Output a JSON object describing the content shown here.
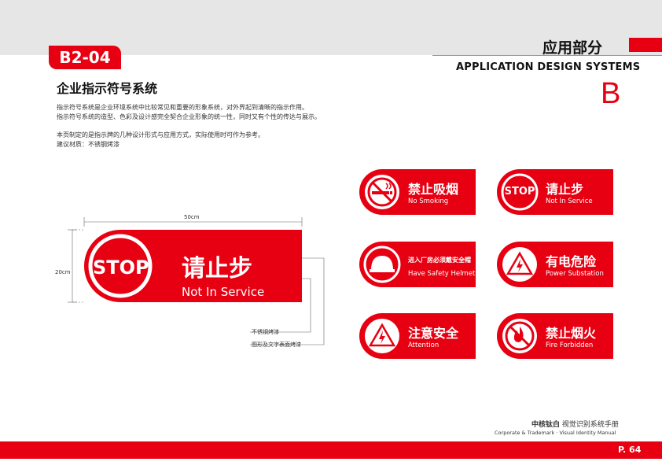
{
  "header": {
    "code": "B2-04",
    "section_cn": "应用部分",
    "section_en": "APPLICATION DESIGN SYSTEMS",
    "section_letter": "B"
  },
  "page_title": "企业指示符号系统",
  "description": [
    "指示符号系统是企业环境系统中比较常见和重要的形象系统，对外界起到清晰的指示作用。",
    "指示符号系统的造型、色彩及设计感完全契合企业形象的统一性，同时又有个性的传达与展示。",
    "本页制定的是指示牌的几种设计形式与应用方式，实际使用时可作为参考。",
    "建议材质：不锈钢烤漆"
  ],
  "main_sign": {
    "width_label": "50cm",
    "height_label": "20cm",
    "stop": "STOP",
    "cn": "请止步",
    "en": "Not In Service",
    "note1": "不锈钢烤漆",
    "note2": "图形及文字表面烤漆"
  },
  "signs": [
    {
      "cn": "禁止吸烟",
      "en": "No Smoking",
      "icon": "no-smoking-icon"
    },
    {
      "cn": "请止步",
      "en": "Not In Service",
      "icon": "stop-icon",
      "stop": "STOP"
    },
    {
      "cn": "进入厂房必须戴安全帽",
      "en": "Have Safety Helmet",
      "icon": "helmet-icon"
    },
    {
      "cn": "有电危险",
      "en": "Power Substation",
      "icon": "electric-hazard-icon"
    },
    {
      "cn": "注意安全",
      "en": "Attention",
      "icon": "warning-icon"
    },
    {
      "cn": "禁止烟火",
      "en": "Fire Forbidden",
      "icon": "no-fire-icon"
    }
  ],
  "footer": {
    "brand_cn_bold": "中核钛白",
    "brand_cn": "视觉识别系统手册",
    "brand_en": "Corporate & Trademark · Visual Identity Manual",
    "page": "P. 64"
  },
  "colors": {
    "accent": "#e60012",
    "bar": "#e6e6e6"
  }
}
